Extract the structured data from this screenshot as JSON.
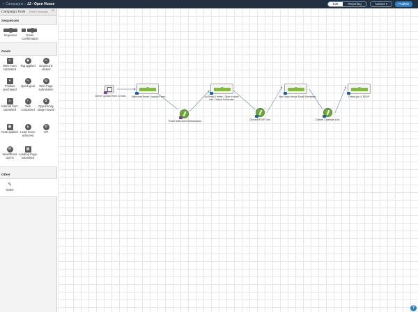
{
  "header": {
    "breadcrumb": "Campaigns",
    "separator": "›",
    "title": "JJ - Open House",
    "tabs": [
      "Edit",
      "Reporting"
    ],
    "actions_label": "Actions",
    "publish_label": "Publish"
  },
  "sidebar": {
    "title": "Campaign Tools",
    "subtitle": "Select Campaign",
    "sections": {
      "sequences": {
        "title": "Sequences",
        "items": [
          {
            "label": "Sequence",
            "icon": "sequence-icon"
          },
          {
            "label": "Email Confirmation",
            "icon": "email-confirmation-icon"
          }
        ]
      },
      "goals": {
        "title": "Goals",
        "items": [
          {
            "label": "Web Form submitted",
            "icon": "form-icon"
          },
          {
            "label": "Tag applied",
            "icon": "tag-icon"
          },
          {
            "label": "Email Link clicked",
            "icon": "link-icon"
          },
          {
            "label": "Product purchased",
            "icon": "cart-icon"
          },
          {
            "label": "Quick goal",
            "icon": "quick-goal-icon"
          },
          {
            "label": "Web Page submission",
            "icon": "web-page-icon"
          },
          {
            "label": "Internal form submitted",
            "icon": "internal-form-icon"
          },
          {
            "label": "Task completed",
            "icon": "task-icon"
          },
          {
            "label": "Opportunity stage moved",
            "icon": "opportunity-icon"
          },
          {
            "label": "Note applied",
            "icon": "note-icon"
          },
          {
            "label": "Lead Score achieved",
            "icon": "lead-score-icon"
          },
          {
            "label": "API",
            "icon": "api-icon"
          },
          {
            "label": "WordPress Opt-in",
            "icon": "wordpress-icon"
          },
          {
            "label": "Landing Page submitted",
            "icon": "landing-page-icon"
          }
        ]
      },
      "other": {
        "title": "Other",
        "items": [
          {
            "label": "Notes",
            "icon": "pencil-icon"
          }
        ]
      }
    }
  },
  "canvas": {
    "nodes": [
      {
        "id": "n1",
        "label": "Clever Contact from JJ Instr."
      },
      {
        "id": "n2",
        "label": "Welcome Email / Inquiry Form"
      },
      {
        "id": "n3",
        "label": "Read until Open Ambassador"
      },
      {
        "id": "n4",
        "label": "1st Email / Invite / Open House Info / Visual Reminder"
      },
      {
        "id": "n5",
        "label": "Clicked RSVP Link"
      },
      {
        "id": "n6",
        "label": "Yes Open House Email Reminder"
      },
      {
        "id": "n7",
        "label": "Clicked Calendar Link"
      },
      {
        "id": "n8",
        "label": "Thank you & RSVP"
      }
    ]
  },
  "colors": {
    "topbar": "#22303f",
    "accent": "#2f7fc1",
    "sequence_green": "#86b848",
    "badge_blue": "#1f5fa8",
    "badge_purple": "#7b3fa0"
  },
  "help_label": "?"
}
